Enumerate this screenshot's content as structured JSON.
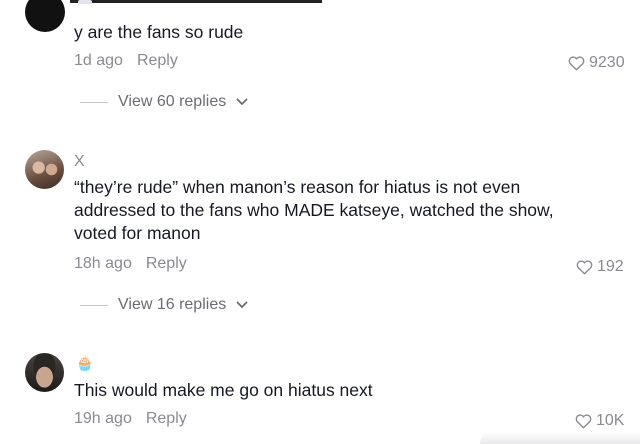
{
  "comments": [
    {
      "username": "",
      "text": "y are the fans so rude",
      "time": "1d ago",
      "reply_label": "Reply",
      "likes": "9230",
      "view_replies": "View 60 replies",
      "avatar_color": "#111111"
    },
    {
      "username": "X",
      "text": "“they’re rude” when manon’s reason for hiatus is not even addressed to the fans who MADE katseye, watched the show, voted for manon",
      "time": "18h ago",
      "reply_label": "Reply",
      "likes": "192",
      "view_replies": "View 16 replies"
    },
    {
      "username": "",
      "user_emoji": "🧁",
      "text": "This would make me go on hiatus next",
      "time": "19h ago",
      "reply_label": "Reply",
      "likes": "10K"
    }
  ],
  "icons": {
    "like": "heart-outline-icon",
    "expand": "chevron-down-icon"
  },
  "colors": {
    "text_primary": "#161823",
    "text_secondary": "#8a8b91"
  }
}
